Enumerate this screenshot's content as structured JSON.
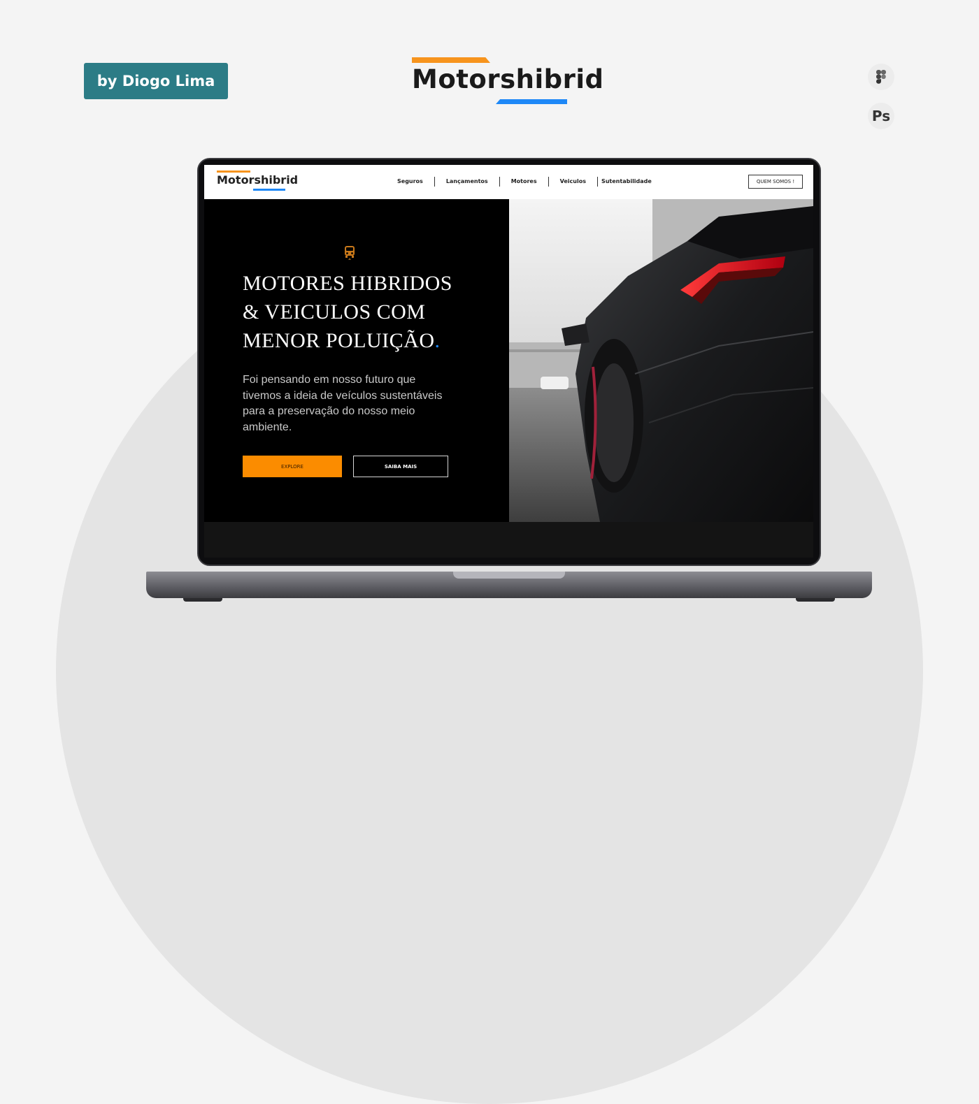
{
  "author": "by Diogo Lima",
  "brand": "Motorshibrid",
  "tools": {
    "figma_icon": "figma-icon",
    "photoshop": "Ps"
  },
  "colors": {
    "accent_orange": "#f7941d",
    "accent_blue": "#1e88f7",
    "badge_teal": "#2c7c86",
    "explore_button": "#fb8c00"
  },
  "site": {
    "logo": "Motorshibrid",
    "nav": [
      "Seguros",
      "Lançamentos",
      "Motores",
      "Veiculos",
      "Sutentabilidade"
    ],
    "about_button": "QUEM SOMOS !",
    "hero": {
      "title_line1": "MOTORES HIBRIDOS",
      "title_line2": "& VEICULOS COM",
      "title_line3": "MENOR POLUIÇÃO",
      "title_dot": ".",
      "description": "Foi pensando em nosso futuro que tivemos a ideia de veículos sustentáveis para a preservação do nosso meio ambiente.",
      "explore_button": "EXPLORE",
      "more_button": "SAIBA MAIS",
      "icon": "car-icon",
      "image": "black-sports-car-rear-photo"
    }
  }
}
